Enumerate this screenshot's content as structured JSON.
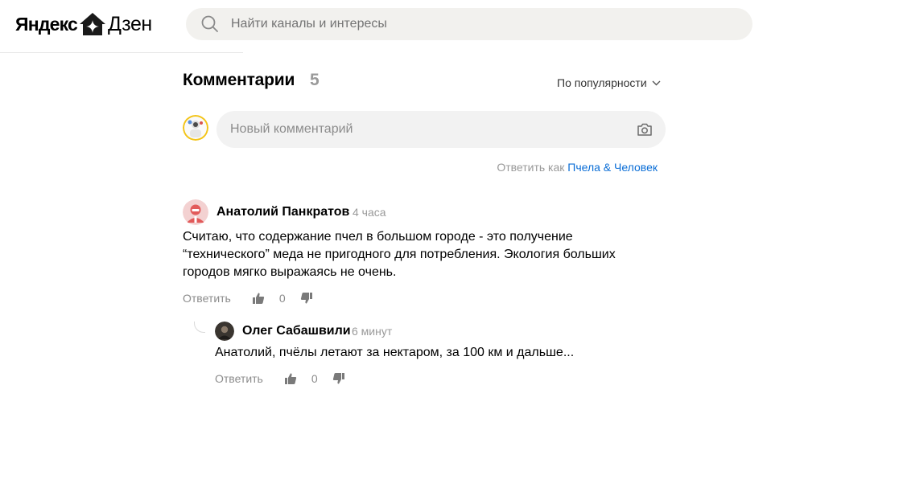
{
  "header": {
    "logo_yandex": "Яндекс",
    "logo_dzen": "Дзен",
    "search_placeholder": "Найти каналы и интересы"
  },
  "comments": {
    "title": "Комментарии",
    "count": "5",
    "sort_label": "По популярности",
    "new_comment_placeholder": "Новый комментарий",
    "reply_as_prefix": "Ответить как",
    "reply_as_name": "Пчела & Человек",
    "items": [
      {
        "author": "Анатолий Панкратов",
        "time": "4 часа",
        "text": "Считаю, что содержание пчел в большом городе - это получение “технического” меда не пригодного для потребления. Экология больших городов мягко выражаясь не очень.",
        "reply_label": "Ответить",
        "votes": "0"
      },
      {
        "author": "Олег Сабашвили",
        "time": "6 минут",
        "text": "Анатолий, пчёлы летают за нектаром, за 100 км и дальше...",
        "reply_label": "Ответить",
        "votes": "0"
      }
    ]
  },
  "colors": {
    "link": "#0a6dd6",
    "muted": "#999999",
    "input_bg": "#f2f2f2"
  },
  "icons": {
    "logo": "house-star-icon",
    "search": "search-icon",
    "sort": "chevron-down-icon",
    "camera": "camera-icon",
    "like": "thumbs-up-icon",
    "dislike": "thumbs-down-icon"
  }
}
